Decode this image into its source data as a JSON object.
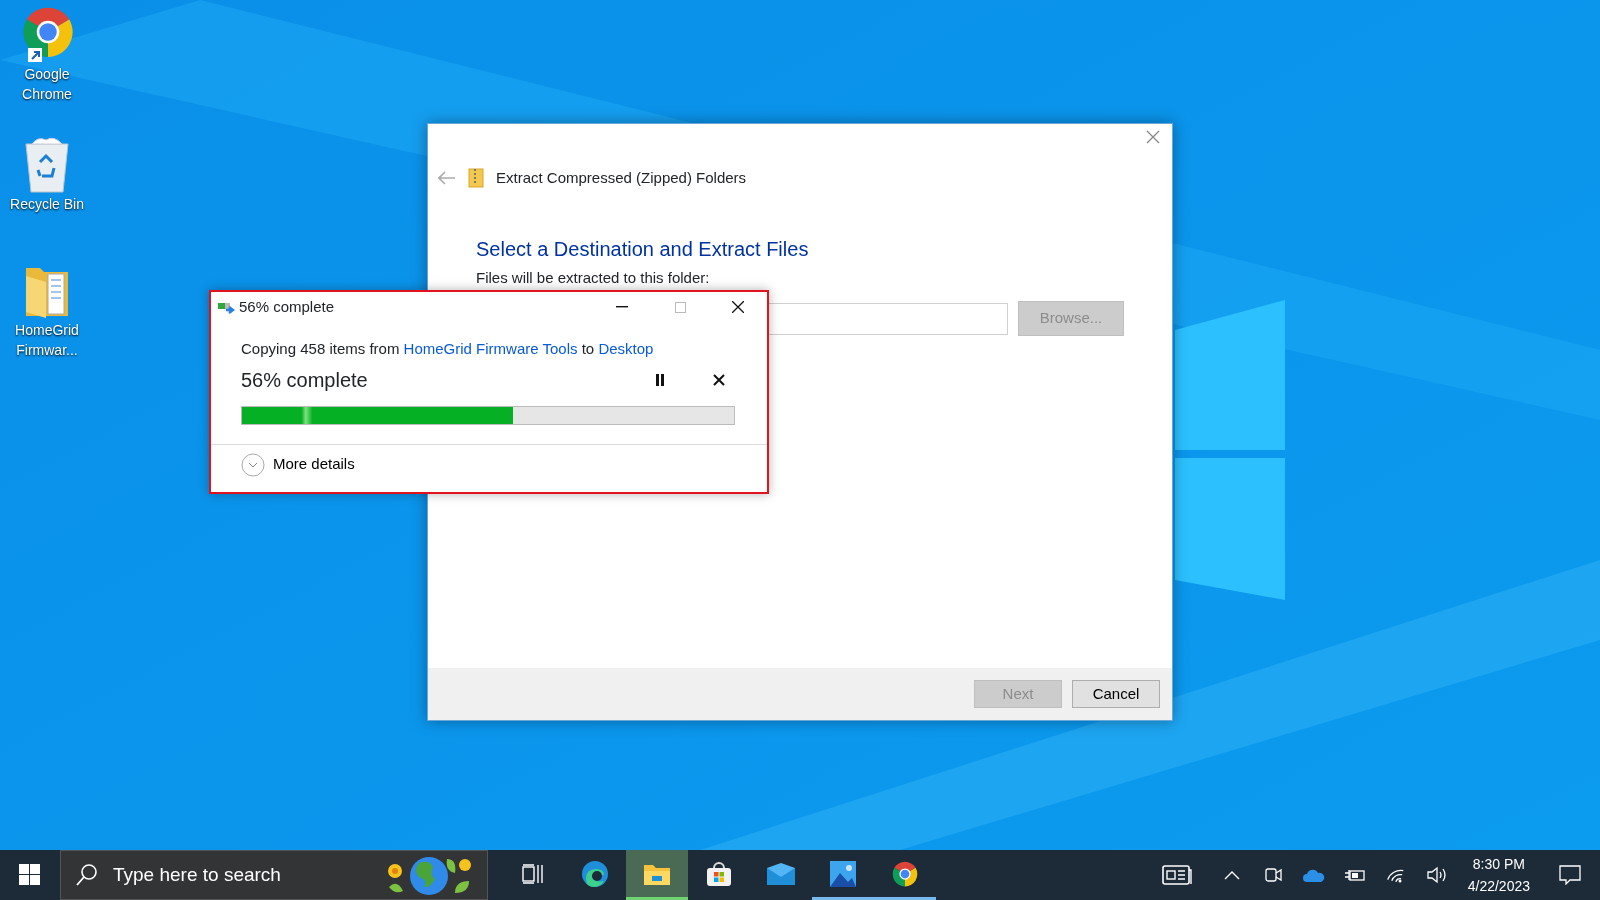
{
  "desktop_icons": [
    {
      "kind": "chrome",
      "label": "Google Chrome"
    },
    {
      "kind": "recycle_bin",
      "label": "Recycle Bin"
    },
    {
      "kind": "folder",
      "label": "HomeGrid Firmwar..."
    }
  ],
  "extract_dialog": {
    "title": "Extract Compressed (Zipped) Folders",
    "heading": "Select a Destination and Extract Files",
    "folder_label": "Files will be extracted to this folder:",
    "browse_button": "Browse...",
    "buttons": [
      {
        "label": "Next",
        "disabled": true
      },
      {
        "label": "Cancel",
        "disabled": false
      }
    ]
  },
  "progress_dialog": {
    "title": "56% complete",
    "message_parts": [
      {
        "kind": "text",
        "text": "Copying 458 items from "
      },
      {
        "kind": "link",
        "text": "HomeGrid Firmware Tools"
      },
      {
        "kind": "text",
        "text": " to "
      },
      {
        "kind": "link",
        "text": "Desktop"
      }
    ],
    "status": "56% complete",
    "level": 0.55,
    "more_details": "More details"
  },
  "taskbar": {
    "search_placeholder": "Type here to search",
    "apps": [
      {
        "kind": "edge",
        "selected": false,
        "running": false
      },
      {
        "kind": "explorer",
        "selected": true,
        "running": true
      },
      {
        "kind": "store",
        "selected": false,
        "running": false
      },
      {
        "kind": "mail",
        "selected": false,
        "running": false
      },
      {
        "kind": "photos",
        "selected": false,
        "running": true
      },
      {
        "kind": "chrome",
        "selected": false,
        "running": true
      }
    ],
    "time": "8:30 PM",
    "date": "4/22/2023"
  }
}
